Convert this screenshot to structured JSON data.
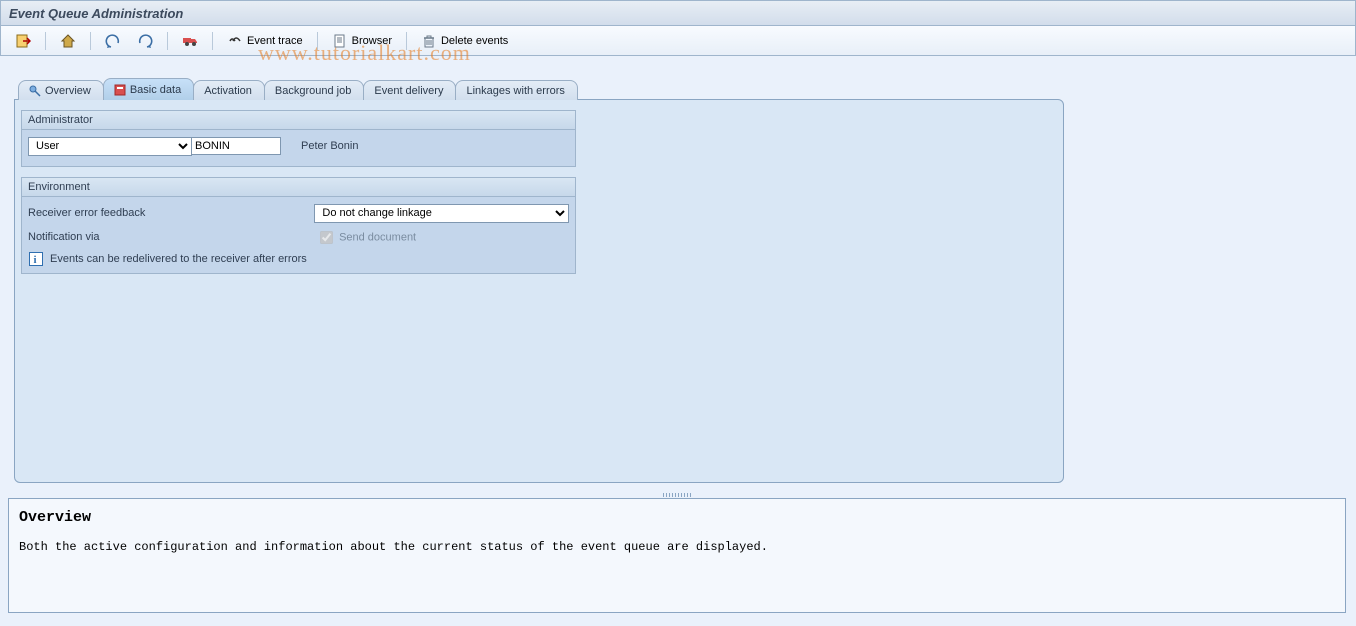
{
  "title": "Event Queue Administration",
  "watermark": "www.tutorialkart.com",
  "toolbar": {
    "event_trace": "Event trace",
    "browser": "Browser",
    "delete_events": "Delete events"
  },
  "tabs": {
    "overview": "Overview",
    "basic_data": "Basic data",
    "activation": "Activation",
    "background_job": "Background job",
    "event_delivery": "Event delivery",
    "linkages_errors": "Linkages with errors"
  },
  "admin_group": {
    "title": "Administrator",
    "type_label": "User",
    "user_id": "BONIN",
    "user_name": "Peter Bonin"
  },
  "env_group": {
    "title": "Environment",
    "feedback_label": "Receiver error feedback",
    "feedback_value": "Do not change linkage",
    "notify_label": "Notification via",
    "send_doc": "Send document",
    "info_text": "Events can be redelivered to the receiver after errors"
  },
  "overview": {
    "heading": "Overview",
    "body": "Both the active configuration and information about the current status of the event queue are displayed."
  }
}
